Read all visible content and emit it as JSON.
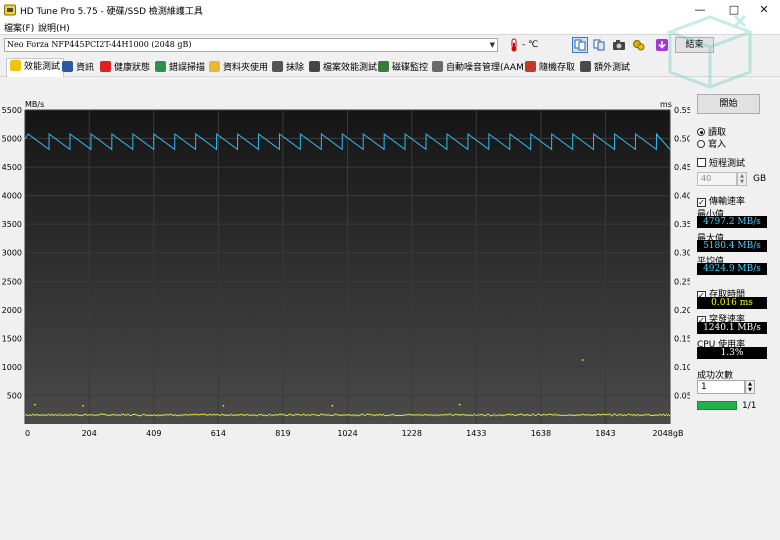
{
  "window": {
    "title": "HD Tune Pro 5.75 - 硬碟/SSD 檢測維護工具",
    "controls": {
      "minimize": "—",
      "maximize": "□",
      "close": "✕"
    }
  },
  "menu": {
    "file": "檔案(F)",
    "help": "說明(H)"
  },
  "toolbar": {
    "drive": "Neo Forza NFP445PCI2T-44H1000 (2048 gB)",
    "temperature": "- ℃",
    "exit_label": "結束"
  },
  "tabs": [
    {
      "label": "效能測試",
      "icon": "benchmark-icon"
    },
    {
      "label": "資訊",
      "icon": "info-icon"
    },
    {
      "label": "健康狀態",
      "icon": "health-icon"
    },
    {
      "label": "錯誤掃描",
      "icon": "scan-icon"
    },
    {
      "label": "資料夾使用",
      "icon": "folder-icon"
    },
    {
      "label": "抹除",
      "icon": "erase-icon"
    },
    {
      "label": "檔案效能測試",
      "icon": "file-benchmark-icon"
    },
    {
      "label": "磁碟監控",
      "icon": "monitor-icon"
    },
    {
      "label": "自動噪音管理(AAM)",
      "icon": "speaker-icon"
    },
    {
      "label": "隨機存取",
      "icon": "random-access-icon"
    },
    {
      "label": "額外測試",
      "icon": "extra-tests-icon"
    }
  ],
  "panel": {
    "start_label": "開始",
    "read_label": "讀取",
    "write_label": "寫入",
    "short_test_label": "短程測試",
    "gb_value": "40",
    "gb_unit": "GB",
    "transfer_label": "傳輸速率",
    "min_label": "最小值",
    "min_value": "4797.2 MB/s",
    "max_label": "最大值",
    "max_value": "5180.4 MB/s",
    "avg_label": "平均值",
    "avg_value": "4924.9 MB/s",
    "access_label": "存取時間",
    "access_value": "0.016 ms",
    "burst_label": "突發速率",
    "burst_value": "1240.1 MB/s",
    "cpu_label": "CPU 使用率",
    "cpu_value": "1.3%",
    "passes_label": "成功次數",
    "passes_value": "1",
    "progress_text": "1/1",
    "progress": 1.0
  },
  "chart_data": {
    "type": "line",
    "xlabel": "gB",
    "ylabel_left": "MB/s",
    "ylabel_right": "ms",
    "xlim": [
      0,
      2048
    ],
    "ylim_left": [
      0,
      5500
    ],
    "ylim_right": [
      0,
      0.55
    ],
    "x_ticks": [
      0,
      204,
      409,
      614,
      819,
      1024,
      1228,
      1433,
      1638,
      1843,
      2048
    ],
    "x_tick_labels": [
      "0",
      "204",
      "409",
      "614",
      "819",
      "1024",
      "1228",
      "1433",
      "1638",
      "1843",
      "2048gB"
    ],
    "y_ticks_left": [
      500,
      1000,
      1500,
      2000,
      2500,
      3000,
      3500,
      4000,
      4500,
      5000,
      5500
    ],
    "y_ticks_right": [
      0.05,
      0.1,
      0.15,
      0.2,
      0.25,
      0.3,
      0.35,
      0.4,
      0.45,
      0.5,
      0.55
    ],
    "grid": true,
    "series": [
      {
        "name": "transfer",
        "color": "#33bbee",
        "sawtooth": {
          "high": 5080,
          "low": 4810,
          "period_gb": 66.5,
          "start_level": 4990
        }
      },
      {
        "name": "access",
        "color": "#e8e83a",
        "level_ms": 0.016,
        "outliers": [
          [
            31,
            0.034
          ],
          [
            184,
            0.032
          ],
          [
            630,
            0.032
          ],
          [
            976,
            0.032
          ],
          [
            1380,
            0.034
          ],
          [
            1771,
            0.112
          ]
        ]
      }
    ]
  }
}
